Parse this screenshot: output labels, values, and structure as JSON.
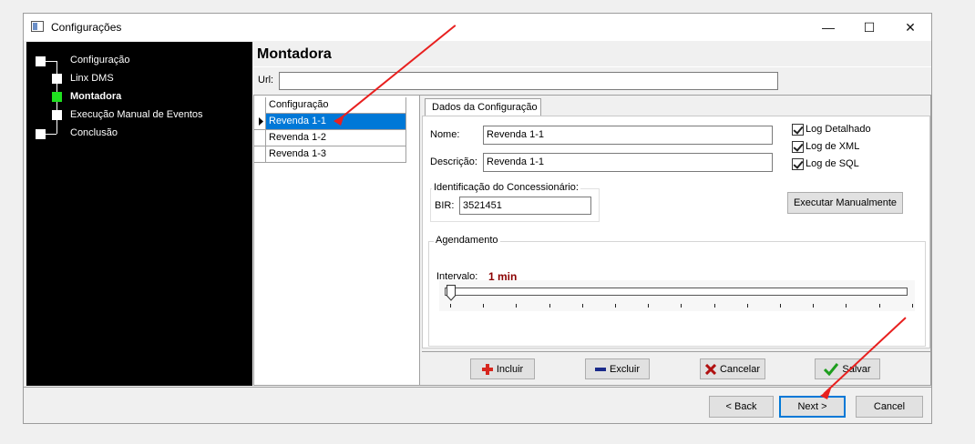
{
  "window": {
    "title": "Configurações",
    "minimize": "—",
    "maximize": "☐",
    "close": "✕"
  },
  "wizard_steps": [
    {
      "label": "Configuração",
      "state": "done"
    },
    {
      "label": "Linx DMS",
      "state": "done"
    },
    {
      "label": "Montadora",
      "state": "current"
    },
    {
      "label": "Execução Manual de Eventos",
      "state": "pending"
    },
    {
      "label": "Conclusão",
      "state": "pending"
    }
  ],
  "page": {
    "title": "Montadora",
    "url_label": "Url:",
    "url_value": ""
  },
  "grid": {
    "header": "Configuração",
    "rows": [
      "Revenda 1-1",
      "Revenda 1-2",
      "Revenda 1-3"
    ],
    "selected_row": "Revenda 1-1"
  },
  "tab": {
    "label": "Dados da Configuração"
  },
  "form": {
    "nome_label": "Nome:",
    "nome_value": "Revenda 1-1",
    "descricao_label": "Descrição:",
    "descricao_value": "Revenda 1-1",
    "ident_group": "Identificação do Concessionário:",
    "bir_label": "BIR:",
    "bir_value": "3521451",
    "log_detalhado": "Log Detalhado",
    "log_xml": "Log de XML",
    "log_sql": "Log de SQL",
    "executar_button": "Executar Manualmente",
    "agendamento_group": "Agendamento",
    "intervalo_label": "Intervalo:",
    "intervalo_value": "1 min",
    "intervalo_slider_position": 0
  },
  "actions": {
    "incluir": "Incluir",
    "excluir": "Excluir",
    "cancelar": "Cancelar",
    "salvar": "Salvar"
  },
  "footer": {
    "back": "< Back",
    "next": "Next >",
    "cancel": "Cancel"
  },
  "colors": {
    "accent": "#0078d7",
    "annotation_arrow": "#e8201f",
    "interval_value": "#8b0000",
    "active_step": "#1fe01f"
  }
}
